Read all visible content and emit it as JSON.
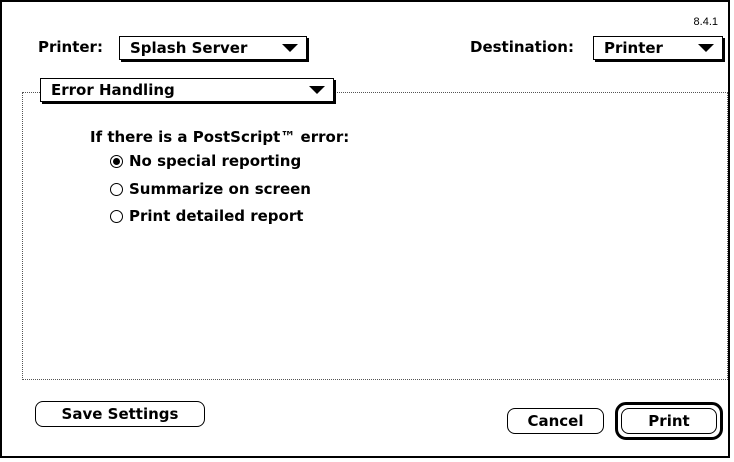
{
  "version": "8.4.1",
  "printer": {
    "label": "Printer:",
    "value": "Splash Server",
    "icon": "chevron-down-icon"
  },
  "destination": {
    "label": "Destination:",
    "value": "Printer",
    "icon": "chevron-down-icon"
  },
  "panel": {
    "value": "Error Handling",
    "icon": "chevron-down-icon"
  },
  "error_section": {
    "heading": "If there is a PostScript™ error:",
    "options": [
      {
        "label": "No special reporting",
        "selected": true
      },
      {
        "label": "Summarize on screen",
        "selected": false
      },
      {
        "label": "Print detailed report",
        "selected": false
      }
    ]
  },
  "buttons": {
    "save_settings": "Save Settings",
    "cancel": "Cancel",
    "print": "Print"
  }
}
